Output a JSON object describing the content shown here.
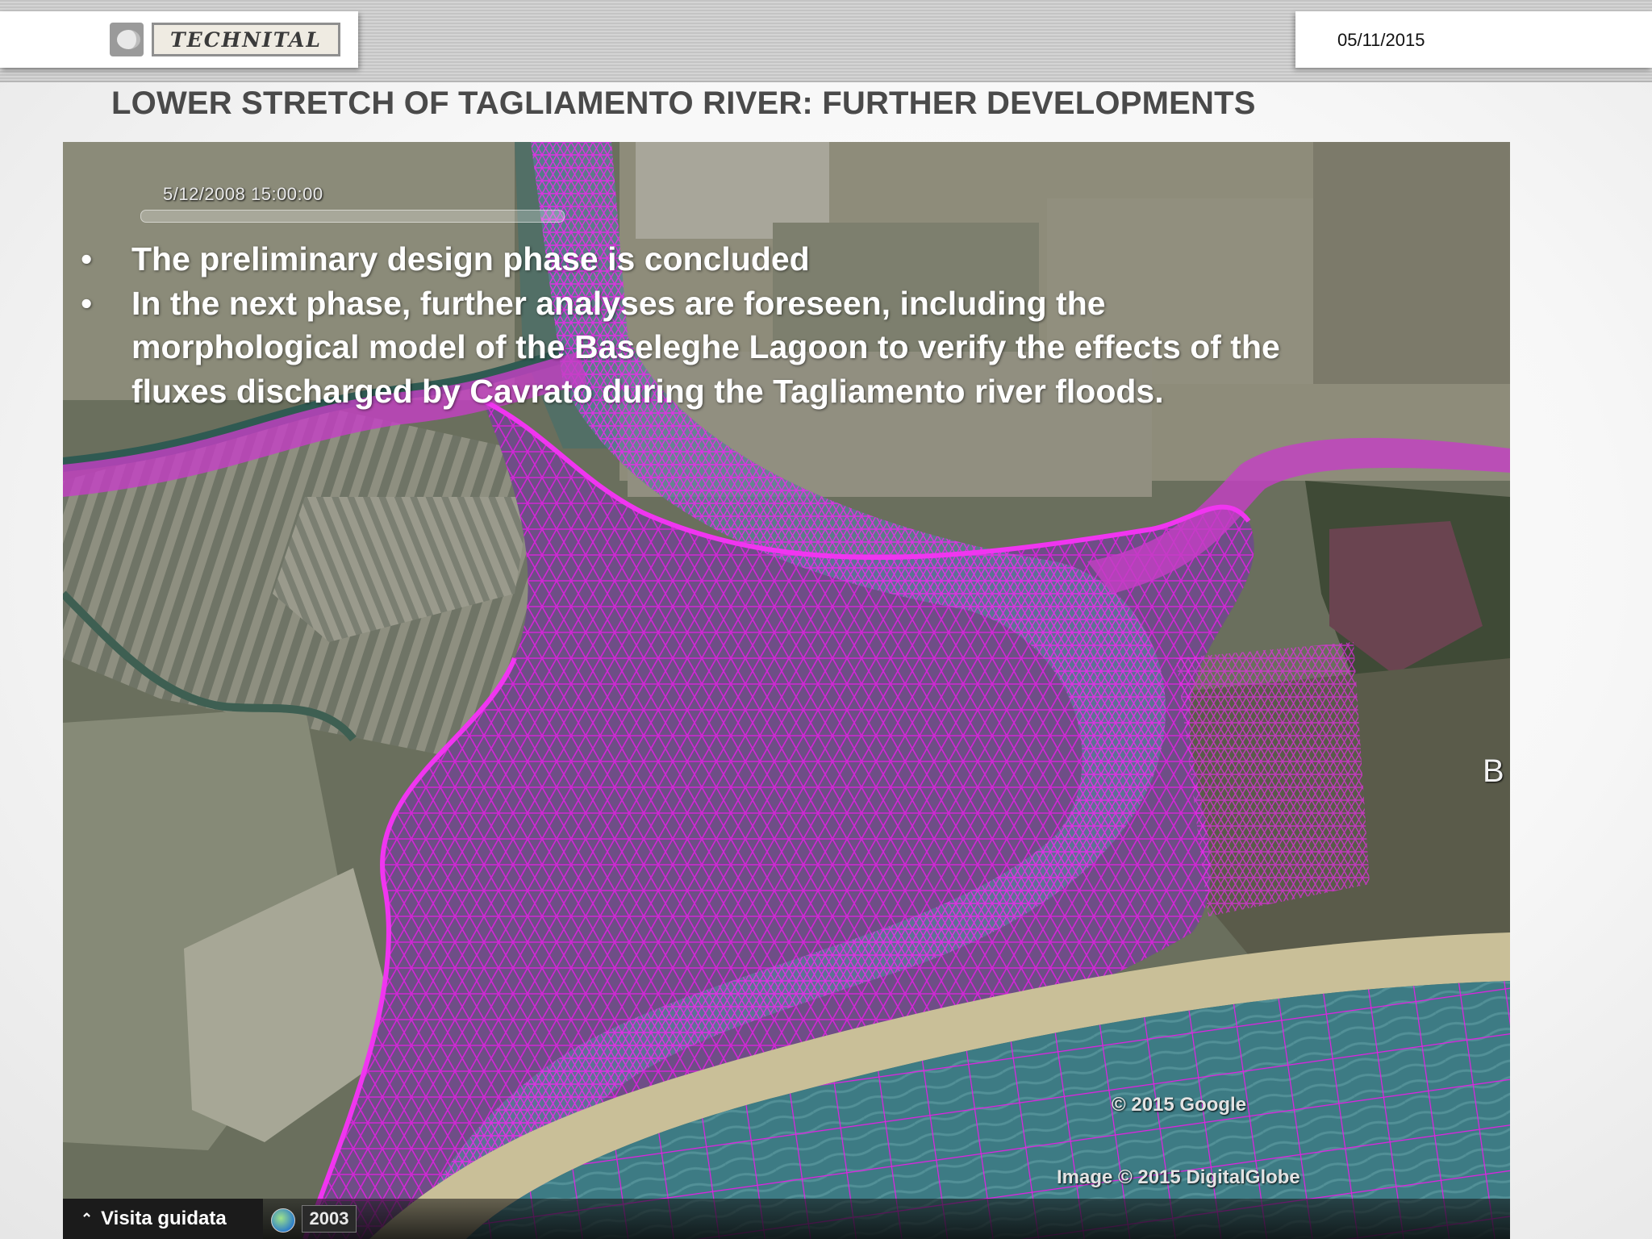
{
  "header": {
    "logo_text": "TECHNITAL",
    "date": "05/11/2015"
  },
  "slide": {
    "title": "LOWER STRETCH OF TAGLIAMENTO RIVER: FURTHER DEVELOPMENTS",
    "bullet_symbol": "•",
    "bullets": [
      "The preliminary design phase is concluded",
      "In the next phase, further analyses are foreseen, including the morphological model of the Baseleghe Lagoon to verify the effects of the fluxes discharged by Cavrato during the Tagliamento river floods."
    ]
  },
  "map": {
    "timestamp": "5/12/2008 15:00:00",
    "copyright_google": "© 2015 Google",
    "copyright_image": "Image © 2015 DigitalGlobe",
    "edge_label": "B",
    "tour_label": "Visita guidata",
    "tour_caret": "⌃",
    "year": "2003",
    "mesh_color": "#e020e0",
    "water_color": "#3f7f86"
  }
}
